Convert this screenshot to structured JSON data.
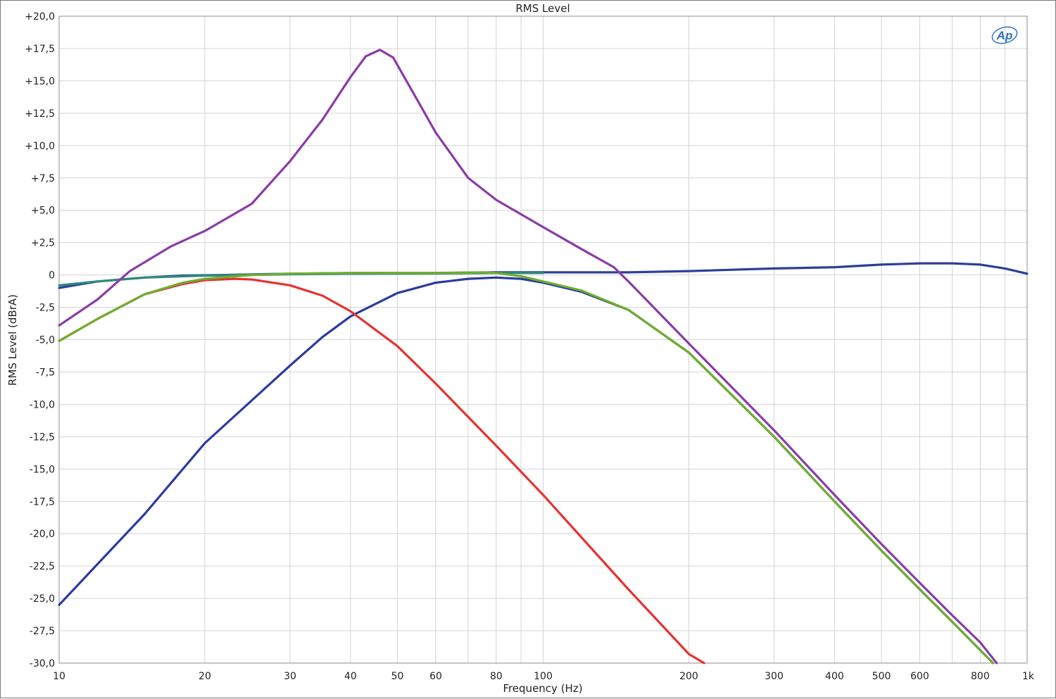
{
  "chart_data": {
    "type": "line",
    "title": "RMS Level",
    "xlabel": "Frequency (Hz)",
    "ylabel": "RMS Level (dBrA)",
    "xscale": "log",
    "xlim": [
      10,
      1000
    ],
    "ylim": [
      -30,
      20
    ],
    "grid": true,
    "logo": "Ap",
    "x_ticks": [
      {
        "v": 10,
        "label": "10"
      },
      {
        "v": 20,
        "label": "20"
      },
      {
        "v": 30,
        "label": "30"
      },
      {
        "v": 40,
        "label": "40"
      },
      {
        "v": 50,
        "label": "50"
      },
      {
        "v": 60,
        "label": "60"
      },
      {
        "v": 80,
        "label": "80"
      },
      {
        "v": 100,
        "label": "100"
      },
      {
        "v": 200,
        "label": "200"
      },
      {
        "v": 300,
        "label": "300"
      },
      {
        "v": 400,
        "label": "400"
      },
      {
        "v": 500,
        "label": "500"
      },
      {
        "v": 600,
        "label": "600"
      },
      {
        "v": 800,
        "label": "800"
      },
      {
        "v": 1000,
        "label": "1k"
      }
    ],
    "y_ticks": [
      {
        "v": 20,
        "label": "+20,0"
      },
      {
        "v": 17.5,
        "label": "+17,5"
      },
      {
        "v": 15,
        "label": "+15,0"
      },
      {
        "v": 12.5,
        "label": "+12,5"
      },
      {
        "v": 10,
        "label": "+10,0"
      },
      {
        "v": 7.5,
        "label": "+7,5"
      },
      {
        "v": 5,
        "label": "+5,0"
      },
      {
        "v": 2.5,
        "label": "+2,5"
      },
      {
        "v": 0,
        "label": "0"
      },
      {
        "v": -2.5,
        "label": "-2,5"
      },
      {
        "v": -5,
        "label": "-5,0"
      },
      {
        "v": -7.5,
        "label": "-7,5"
      },
      {
        "v": -10,
        "label": "-10,0"
      },
      {
        "v": -12.5,
        "label": "-12,5"
      },
      {
        "v": -15,
        "label": "-15,0"
      },
      {
        "v": -17.5,
        "label": "-17,5"
      },
      {
        "v": -20,
        "label": "-20,0"
      },
      {
        "v": -22.5,
        "label": "-22,5"
      },
      {
        "v": -25,
        "label": "-25,0"
      },
      {
        "v": -27.5,
        "label": "-27,5"
      },
      {
        "v": -30,
        "label": "-30,0"
      }
    ],
    "series": [
      {
        "color": "#2d3f9a",
        "x": [
          10,
          12,
          15,
          18,
          22,
          30,
          40,
          60,
          80,
          100,
          150,
          200,
          300,
          400,
          500,
          600,
          700,
          800,
          900,
          1000
        ],
        "y": [
          -1.0,
          -0.5,
          -0.2,
          -0.05,
          0,
          0.1,
          0.15,
          0.15,
          0.2,
          0.2,
          0.2,
          0.3,
          0.5,
          0.6,
          0.8,
          0.9,
          0.9,
          0.8,
          0.5,
          0.1
        ]
      },
      {
        "color": "#2e8a7a",
        "x": [
          10,
          12,
          15,
          20,
          30,
          40,
          60,
          80,
          100
        ],
        "y": [
          -0.8,
          -0.5,
          -0.2,
          -0.05,
          0.05,
          0.1,
          0.12,
          0.15,
          0.15
        ]
      },
      {
        "color": "#2b3aa0",
        "x": [
          10,
          15,
          20,
          30,
          35,
          40,
          50,
          60,
          70,
          80,
          90,
          100,
          120,
          150,
          200,
          300,
          400,
          500,
          600,
          700,
          800,
          850
        ],
        "y": [
          -25.5,
          -18.5,
          -13.0,
          -7.0,
          -4.8,
          -3.2,
          -1.4,
          -0.6,
          -0.3,
          -0.2,
          -0.3,
          -0.6,
          -1.3,
          -2.7,
          -6.0,
          -12.5,
          -17.5,
          -21.3,
          -24.3,
          -26.8,
          -29.0,
          -30.0
        ]
      },
      {
        "color": "#e63232",
        "x": [
          10,
          12,
          15,
          18,
          20,
          23,
          25,
          30,
          35,
          40,
          50,
          60,
          80,
          100,
          150,
          200,
          215
        ],
        "y": [
          -5.1,
          -3.4,
          -1.5,
          -0.7,
          -0.4,
          -0.3,
          -0.35,
          -0.8,
          -1.6,
          -2.8,
          -5.5,
          -8.4,
          -13.2,
          -17.0,
          -24.3,
          -29.3,
          -30.0
        ]
      },
      {
        "color": "#6fae2e",
        "x": [
          10,
          12,
          15,
          18,
          20,
          25,
          30,
          40,
          60,
          75,
          80,
          90,
          100,
          120,
          150,
          200,
          300,
          400,
          500,
          600,
          700,
          800,
          850
        ],
        "y": [
          -5.1,
          -3.4,
          -1.5,
          -0.6,
          -0.3,
          0,
          0.1,
          0.15,
          0.15,
          0.2,
          0.15,
          -0.1,
          -0.5,
          -1.2,
          -2.7,
          -6.0,
          -12.5,
          -17.5,
          -21.3,
          -24.3,
          -26.8,
          -29.0,
          -30.0
        ]
      },
      {
        "color": "#8a3ca6",
        "x": [
          10,
          12,
          14,
          17,
          20,
          25,
          30,
          35,
          40,
          43,
          46,
          49,
          55,
          60,
          70,
          80,
          100,
          120,
          140,
          150,
          200,
          300,
          400,
          500,
          600,
          700,
          800,
          865
        ],
        "y": [
          -3.9,
          -1.9,
          0.3,
          2.2,
          3.4,
          5.5,
          8.8,
          12.0,
          15.3,
          16.9,
          17.4,
          16.8,
          13.5,
          11.0,
          7.5,
          5.8,
          3.7,
          2.0,
          0.6,
          -0.5,
          -5.3,
          -12.0,
          -17.0,
          -20.8,
          -23.8,
          -26.3,
          -28.4,
          -30.0
        ]
      }
    ]
  }
}
